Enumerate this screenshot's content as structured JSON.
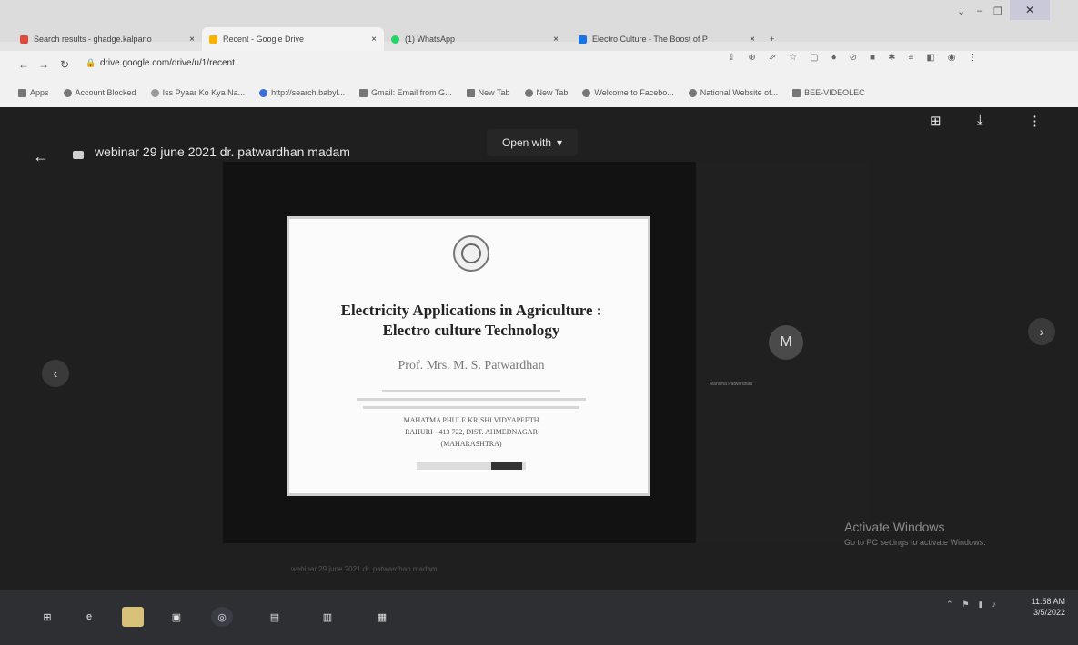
{
  "browser": {
    "tabs": [
      {
        "label": "Search results - ghadge.kalpano"
      },
      {
        "label": "Recent - Google Drive"
      },
      {
        "label": "(1) WhatsApp"
      },
      {
        "label": "Electro Culture - The Boost of P"
      }
    ],
    "new_tab_symbol": "+",
    "url": "drive.google.com/drive/u/1/recent",
    "bookmarks": [
      "Apps",
      "Account Blocked",
      "Iss Pyaar Ko Kya Na...",
      "http://search.babyl...",
      "Gmail: Email from G...",
      "New Tab",
      "New Tab",
      "Welcome to Facebo...",
      "National Website of...",
      "BEE-VIDEOLEC"
    ],
    "colors": {
      "accent": "#4285f4"
    }
  },
  "viewer": {
    "file_title": "webinar 29 june 2021 dr. patwardhan madam",
    "open_with_label": "Open with",
    "participant_initial": "M",
    "participant_name": "Manisha Patwardhan",
    "slide": {
      "title_line1": "Electricity Applications in Agriculture :",
      "title_line2": "Electro culture Technology",
      "presenter": "Prof. Mrs. M. S. Patwardhan",
      "org_line1": "MAHATMA PHULE KRISHI VIDYAPEETH",
      "org_line2": "RAHURI - 413 722, DIST. AHMEDNAGAR",
      "org_line3": "(MAHARASHTRA)"
    }
  },
  "overlay": {
    "activate_title": "Activate Windows",
    "activate_sub": "Go to PC settings to activate Windows.",
    "bottom_caption": "webinar 29 june 2021 dr. patwardhan madam"
  },
  "taskbar": {
    "time": "11:58 AM",
    "date": "3/5/2022"
  }
}
